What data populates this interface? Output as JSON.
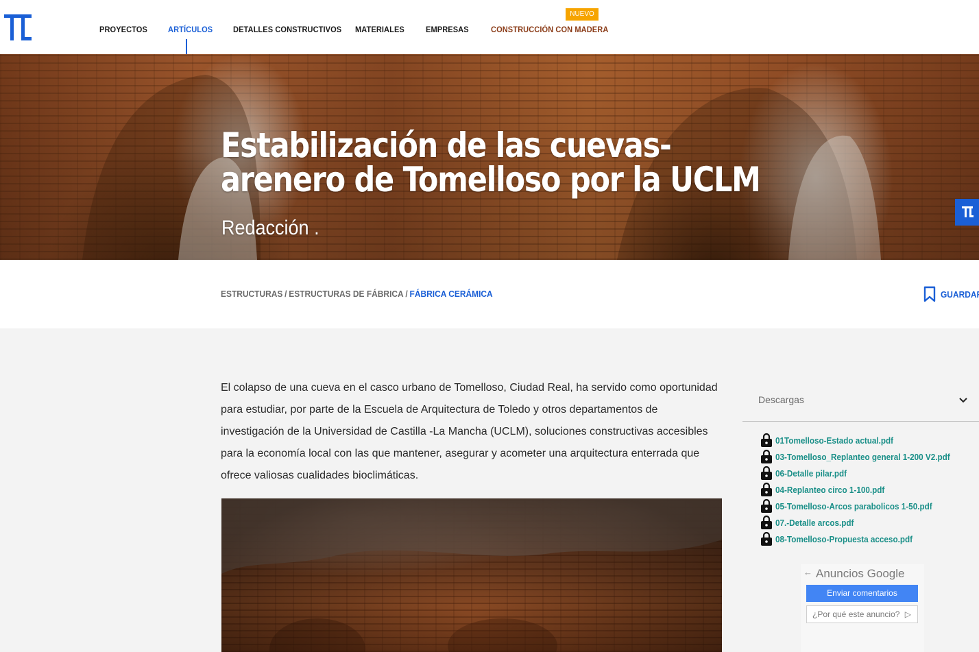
{
  "header": {
    "nav": [
      {
        "label": "PROYECTOS"
      },
      {
        "label": "ARTÍCULOS"
      },
      {
        "label": "DETALLES CONSTRUCTIVOS"
      },
      {
        "label": "MATERIALES"
      },
      {
        "label": "EMPRESAS"
      },
      {
        "label": "CONSTRUCCIÓN CON MADERA"
      }
    ],
    "badge": "NUEVO",
    "colors": {
      "accent": "#1a5fd6",
      "wood": "#8a3b17",
      "badge": "#f6a400"
    }
  },
  "hero": {
    "title": "Estabilización de las cuevas-arenero de Tomelloso por la UCLM",
    "author": "Redacción ."
  },
  "breadcrumb": {
    "items": [
      "ESTRUCTURAS",
      "ESTRUCTURAS DE FÁBRICA",
      "FÁBRICA CERÁMICA"
    ],
    "separator": "/"
  },
  "save": {
    "label": "GUARDAR"
  },
  "article": {
    "paragraph": "El colapso de una cueva en el casco urbano de Tomelloso, Ciudad Real, ha servido como oportunidad para estudiar, por parte de la Escuela de Arquitectura de Toledo y otros departamentos de investigación de la Universidad de Castilla -La Mancha (UCLM), soluciones constructivas accesibles para la economía local con las que mantener, asegurar y acometer una arquitectura enterrada que ofrece valiosas cualidades bioclimáticas."
  },
  "downloads": {
    "title": "Descargas",
    "files": [
      "01Tomelloso-Estado actual.pdf",
      "03-Tomelloso_Replanteo general 1-200 V2.pdf",
      "06-Detalle pilar.pdf",
      "04-Replanteo circo 1-100.pdf",
      "05-Tomelloso-Arcos parabolicos 1-50.pdf",
      "07.-Detalle arcos.pdf",
      "08-Tomelloso-Propuesta acceso.pdf"
    ],
    "link_color": "#1a8f88"
  },
  "ad": {
    "title": "Anuncios Google",
    "feedback_button": "Enviar comentarios",
    "why": "¿Por qué este anuncio?"
  }
}
